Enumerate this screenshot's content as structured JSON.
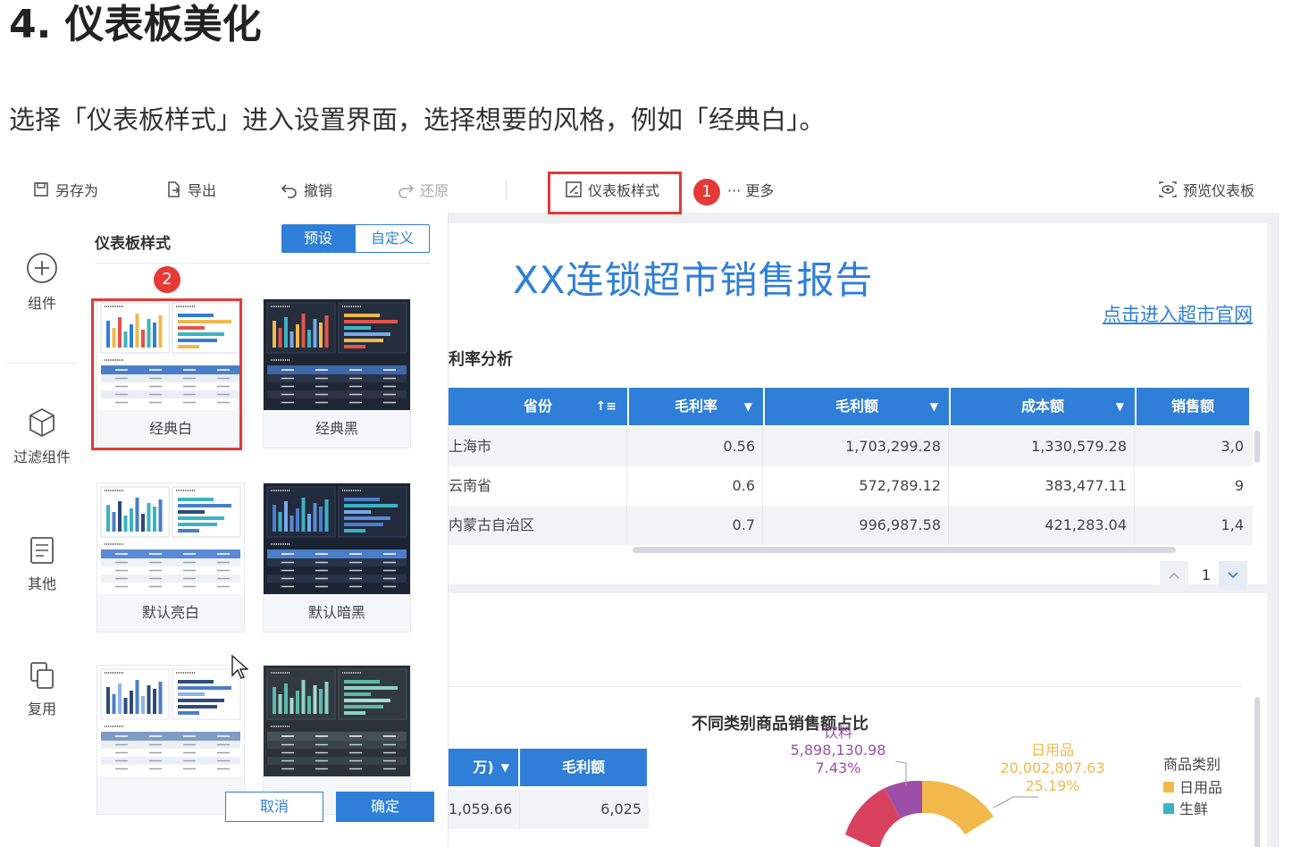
{
  "article": {
    "heading": "4. 仪表板美化",
    "instruction": "选择「仪表板样式」进入设置界面，选择想要的风格，例如「经典白」。"
  },
  "toolbar": {
    "save_as": "另存为",
    "export": "导出",
    "undo": "撤销",
    "redo": "还原",
    "dashboard_style": "仪表板样式",
    "more": "··· 更多",
    "preview": "预览仪表板",
    "step1": "1"
  },
  "left_bar": {
    "items": [
      {
        "label": "组件",
        "icon": "plus-circle-icon"
      },
      {
        "label": "过滤组件",
        "icon": "cube-icon"
      },
      {
        "label": "其他",
        "icon": "document-icon"
      },
      {
        "label": "复用",
        "icon": "copy-icon"
      }
    ]
  },
  "style_panel": {
    "title": "仪表板样式",
    "tabs": [
      "预设",
      "自定义"
    ],
    "active_tab": "预设",
    "step2": "2",
    "presets": [
      "经典白",
      "经典黑",
      "默认亮白",
      "默认暗黑",
      "",
      ""
    ],
    "selected": "经典白",
    "cancel": "取消",
    "confirm": "确定"
  },
  "report": {
    "title": "XX连锁超市销售报告",
    "link": "点击进入超市官网",
    "section_title": "利率分析",
    "columns": [
      "省份",
      "毛利率",
      "毛利额",
      "成本额",
      "销售额"
    ],
    "rows": [
      [
        "上海市",
        "0.56",
        "1,703,299.28",
        "1,330,579.28",
        "3,0"
      ],
      [
        "云南省",
        "0.6",
        "572,789.12",
        "383,477.11",
        "9"
      ],
      [
        "内蒙古自治区",
        "0.7",
        "996,987.58",
        "421,283.04",
        "1,4"
      ]
    ],
    "page": "1"
  },
  "pie_section": {
    "title": "不同类别商品销售额占比",
    "table_headers": [
      "万)",
      "毛利额"
    ],
    "table_row": [
      "1,059.66",
      "6,025"
    ],
    "labels": [
      {
        "name": "饮料",
        "value": "5,898,130.98",
        "percent": "7.43%"
      },
      {
        "name": "日用品",
        "value": "20,002,807.63",
        "percent": "25.19%"
      }
    ],
    "legend_title": "商品类别",
    "legend": [
      {
        "name": "日用品",
        "color": "#f2b84b"
      },
      {
        "name": "生鲜",
        "color": "#3bb3c3"
      }
    ]
  },
  "colors": {
    "accent": "#2f7fd9",
    "highlight": "#e53935"
  }
}
